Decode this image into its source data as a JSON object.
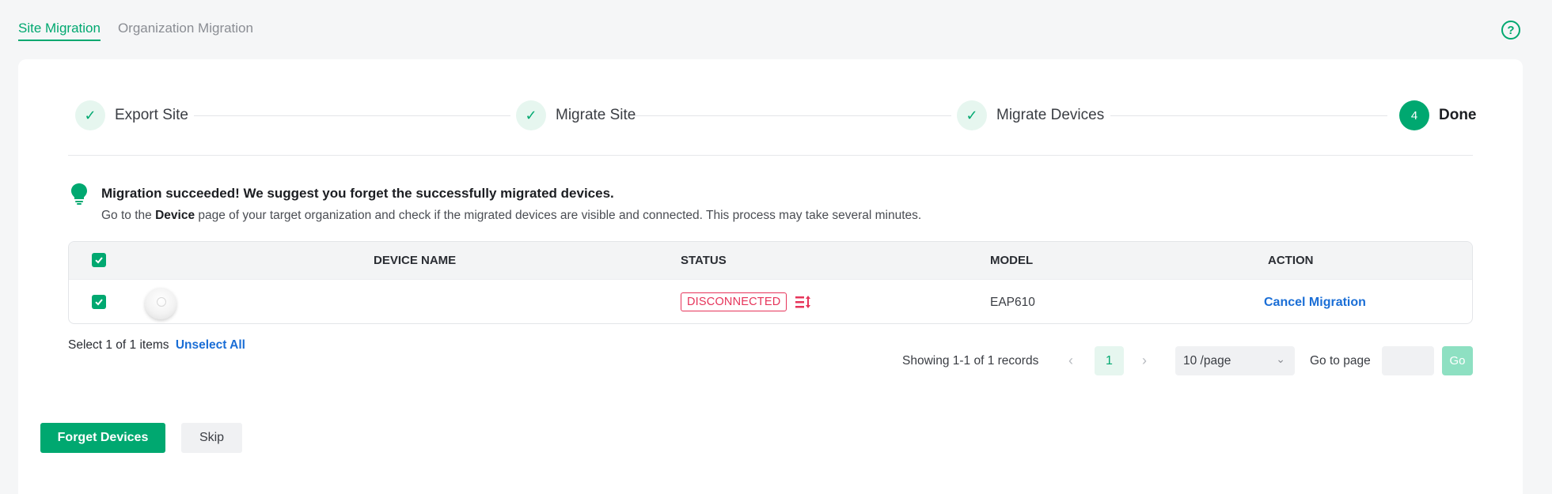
{
  "tabs": [
    {
      "label": "Site Migration",
      "active": true
    },
    {
      "label": "Organization Migration",
      "active": false
    }
  ],
  "help_icon": "question-circle-icon",
  "steps": [
    {
      "label": "Export Site",
      "state": "done"
    },
    {
      "label": "Migrate Site",
      "state": "done"
    },
    {
      "label": "Migrate Devices",
      "state": "done"
    },
    {
      "label": "Done",
      "number": "4",
      "state": "current"
    }
  ],
  "message": {
    "title": "Migration succeeded! We suggest you forget the successfully migrated devices.",
    "sub_prefix": "Go to the ",
    "sub_bold": "Device",
    "sub_suffix": " page of your target organization and check if the migrated devices are visible and connected. This process may take several minutes."
  },
  "table": {
    "headers": {
      "device_name": "DEVICE NAME",
      "status": "STATUS",
      "model": "MODEL",
      "action": "ACTION"
    },
    "rows": [
      {
        "device_name": "",
        "status": "DISCONNECTED",
        "model": "EAP610",
        "action": "Cancel Migration"
      }
    ]
  },
  "selection": {
    "text": "Select 1 of 1 items",
    "unselect_label": "Unselect All"
  },
  "pagination": {
    "showing": "Showing 1-1 of 1 records",
    "current_page": "1",
    "per_page": "10 /page",
    "goto_label": "Go to page",
    "go_label": "Go"
  },
  "buttons": {
    "forget": "Forget Devices",
    "skip": "Skip"
  },
  "colors": {
    "accent": "#00a870",
    "danger": "#e6345a",
    "link": "#1a6ed6"
  }
}
